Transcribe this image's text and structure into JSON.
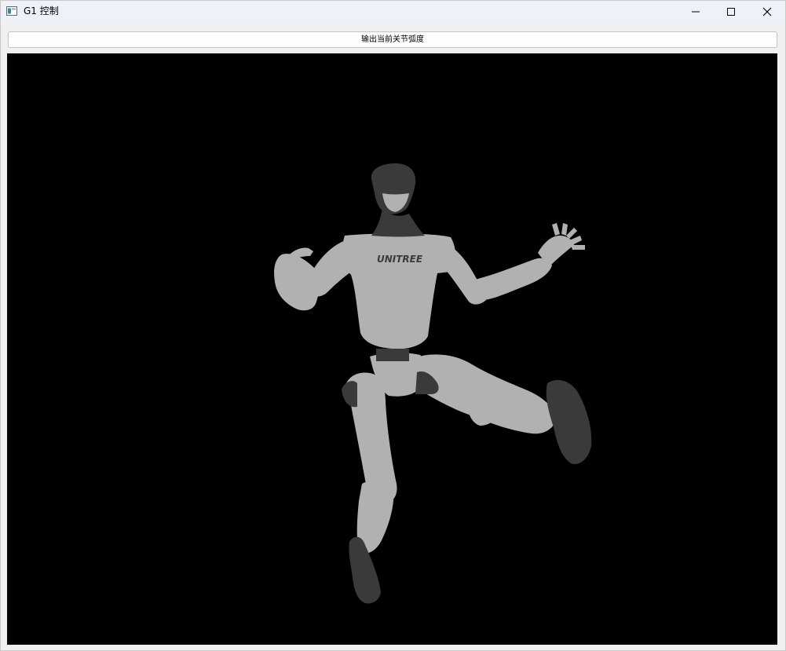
{
  "window": {
    "title": "G1 控制",
    "icon": "app-window-icon",
    "controls": [
      "minimize-icon",
      "maximize-icon",
      "close-icon"
    ]
  },
  "toolbar": {
    "output_button_label": "输出当前关节弧度"
  },
  "viewport": {
    "background": "#000000",
    "robot_body_color": "#b1b1b1",
    "robot_dark_color": "#3a3a3a",
    "robot_logo": "UNITREE"
  }
}
